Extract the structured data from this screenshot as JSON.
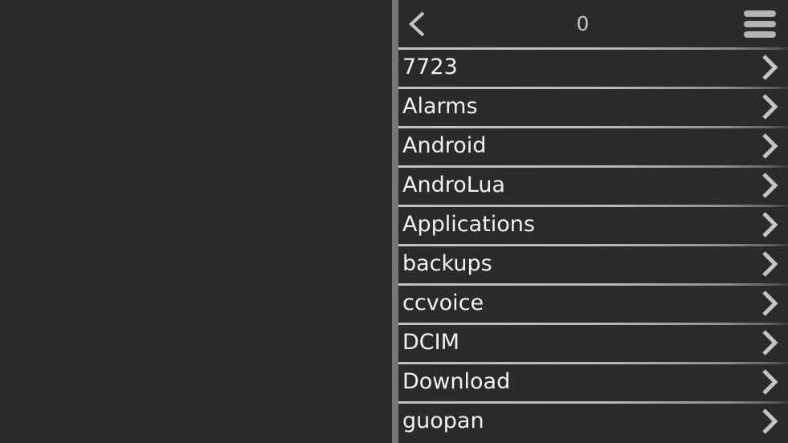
{
  "app": {
    "name": "file-browser",
    "colors": {
      "panel_background": "#2b2b2b",
      "desktop_background": "#2b2b2b",
      "divider_rail": "#757575",
      "separator": "#c2c2c2",
      "text_primary": "#f2f2f2",
      "text_title": "#c9c9c9",
      "icon": "#b4b4b4"
    }
  },
  "header": {
    "back_label": "‹",
    "back_icon": "chevron-left-icon",
    "title": "0",
    "menu_icon": "hamburger-menu-icon"
  },
  "file_list": {
    "chevron_icon": "chevron-right-icon",
    "items": [
      {
        "name": "7723"
      },
      {
        "name": "Alarms"
      },
      {
        "name": "Android"
      },
      {
        "name": "AndroLua"
      },
      {
        "name": "Applications"
      },
      {
        "name": "backups"
      },
      {
        "name": "ccvoice"
      },
      {
        "name": "DCIM"
      },
      {
        "name": "Download"
      },
      {
        "name": "guopan"
      }
    ]
  }
}
